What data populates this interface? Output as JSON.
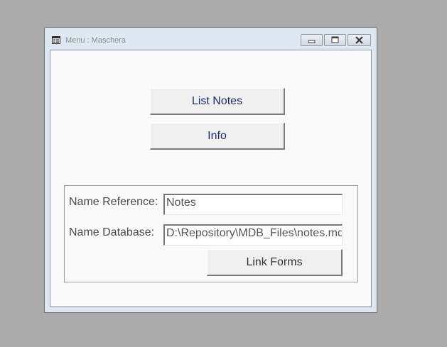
{
  "window": {
    "title": "Menu : Maschera",
    "icons": {
      "app": "form-icon",
      "minimize": "minimize-icon",
      "maximize": "maximize-icon",
      "close": "close-icon"
    }
  },
  "menu": {
    "list_notes_label": "List Notes",
    "info_label": "Info"
  },
  "link_panel": {
    "name_reference_label": "Name Reference:",
    "name_reference_value": "Notes",
    "name_database_label": "Name Database:",
    "name_database_value": "D:\\Repository\\MDB_Files\\notes.mdb",
    "link_forms_label": "Link Forms"
  },
  "colors": {
    "desktop": "#ababab",
    "window_frame": "#dfe7f1",
    "client_background": "#fafafa",
    "menu_button_text": "#1e2b6a"
  }
}
